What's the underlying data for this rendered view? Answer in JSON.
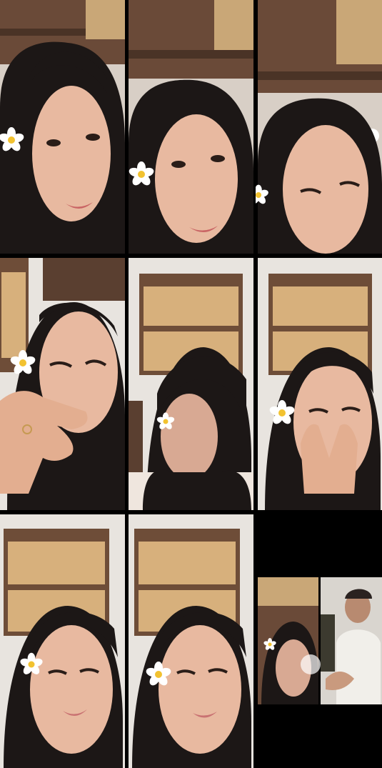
{
  "title": "",
  "grid": {
    "columns": 3,
    "rows": 3,
    "background": "#000000"
  },
  "frames": [
    {
      "id": "frame-1",
      "scene": "ceiling",
      "has_flower": true
    },
    {
      "id": "frame-2",
      "scene": "ceiling",
      "has_flower": true
    },
    {
      "id": "frame-3",
      "scene": "ceiling",
      "has_flower": true
    },
    {
      "id": "frame-4",
      "scene": "shelf-hand",
      "has_flower": true
    },
    {
      "id": "frame-5",
      "scene": "shelf",
      "has_flower": true
    },
    {
      "id": "frame-6",
      "scene": "shelf-hands",
      "has_flower": true
    },
    {
      "id": "frame-7",
      "scene": "shelf",
      "has_flower": true
    },
    {
      "id": "frame-8",
      "scene": "shelf",
      "has_flower": true
    },
    {
      "id": "frame-9",
      "scene": "split",
      "has_flower": true
    }
  ],
  "colors": {
    "skin": "#e8b9a0",
    "hair": "#1c1716",
    "wood": "#d7b07c",
    "ceiling": "#6a4a38",
    "wall": "#e8e4df",
    "flower_petal": "#ffffff",
    "flower_center": "#f2c230"
  }
}
